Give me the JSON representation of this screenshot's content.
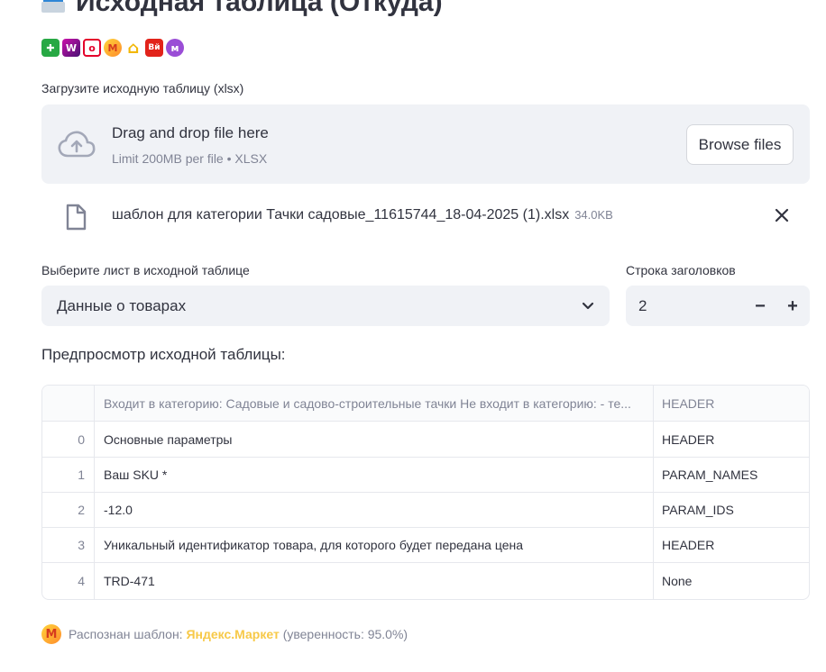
{
  "header": {
    "title": "Исходная таблица (Откуда)",
    "title_icon": "file-box-icon"
  },
  "marketplace_icons": [
    {
      "name": "green-cross-icon",
      "glyph": "+",
      "color": "#27a844"
    },
    {
      "name": "wildberries-icon",
      "glyph": "W",
      "color": "#8b2fc9"
    },
    {
      "name": "ozon-icon",
      "glyph": "o",
      "color": "#e4002b"
    },
    {
      "name": "yandex-market-icon",
      "glyph": "M",
      "color": "#ffcc00"
    },
    {
      "name": "house-icon",
      "glyph": "⌂",
      "color": "#f2b705"
    },
    {
      "name": "vi-icon",
      "glyph": "Вй",
      "color": "#e2231a"
    },
    {
      "name": "megamarket-icon",
      "glyph": "м",
      "color": "#9a4dd6"
    }
  ],
  "upload": {
    "label": "Загрузите исходную таблицу (xlsx)",
    "drop_title": "Drag and drop file here",
    "drop_limit": "Limit 200MB per file • XLSX",
    "browse_label": "Browse files",
    "file_name": "шаблон для категории Тачки садовые_11615744_18-04-2025 (1).xlsx",
    "file_size": "34.0KB"
  },
  "sheet_select": {
    "label": "Выберите лист в исходной таблице",
    "value": "Данные о товарах"
  },
  "header_row": {
    "label": "Строка заголовков",
    "value": "2",
    "minus": "−",
    "plus": "+"
  },
  "preview": {
    "title": "Предпросмотр исходной таблицы:",
    "columns": [
      "",
      "Входит в категорию: Садовые и садово-строительные тачки  Не входит в категорию: - те...",
      "HEADER"
    ],
    "rows": [
      {
        "index": "0",
        "col1": "Основные параметры",
        "col2": "HEADER"
      },
      {
        "index": "1",
        "col1": "Ваш SKU *",
        "col2": "PARAM_NAMES"
      },
      {
        "index": "2",
        "col1": "-12.0",
        "col2": "PARAM_IDS"
      },
      {
        "index": "3",
        "col1": "Уникальный идентификатор товара, для которого будет передана цена",
        "col2": "HEADER"
      },
      {
        "index": "4",
        "col1": "TRD-471",
        "col2": "None"
      }
    ]
  },
  "detection": {
    "prefix": "Распознан шаблон:",
    "brand": "Яндекс.Маркет",
    "suffix": "(уверенность: 95.0%)",
    "brand_color": "#f7c948"
  }
}
